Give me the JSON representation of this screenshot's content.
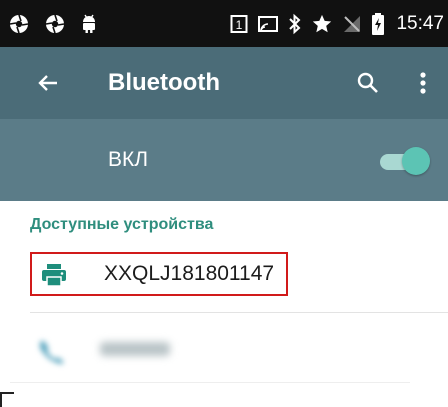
{
  "status_bar": {
    "time": "15:47",
    "left_icons": [
      "aperture-icon",
      "aperture-icon",
      "android-icon"
    ],
    "right_icons": [
      "sim-1-icon",
      "cast-icon",
      "bluetooth-icon",
      "star-icon",
      "no-signal-icon",
      "battery-charging-icon"
    ]
  },
  "toolbar": {
    "title": "Bluetooth",
    "back_icon": "arrow-back-icon",
    "search_icon": "search-icon",
    "more_icon": "more-vert-icon"
  },
  "switch_bar": {
    "label": "ВКЛ",
    "checked": true
  },
  "available_devices": {
    "header": "Доступные устройства",
    "items": [
      {
        "name": "XXQLJ181801147",
        "icon": "printer-icon",
        "highlighted": true
      }
    ]
  },
  "colors": {
    "status_bar_bg": "#111111",
    "toolbar_bg": "#4b6c78",
    "switch_bar_bg": "#5b7c88",
    "accent": "#2f8e7e",
    "highlight_border": "#d11a1a"
  }
}
